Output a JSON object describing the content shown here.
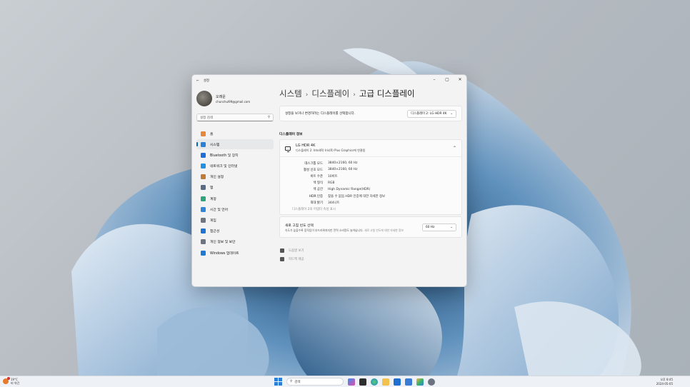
{
  "window": {
    "title": "설정",
    "controls": [
      "minimize",
      "maximize",
      "close"
    ]
  },
  "user": {
    "name": "오래운",
    "email": "chunchul99@gmail.com"
  },
  "search": {
    "placeholder": "설정 검색"
  },
  "sidebar": {
    "items": [
      {
        "label": "홈",
        "icon": "home-icon",
        "color": "#e6873a",
        "active": false
      },
      {
        "label": "시스템",
        "icon": "system-icon",
        "color": "#2b7fd6",
        "active": true
      },
      {
        "label": "Bluetooth 및 장치",
        "icon": "bluetooth-icon",
        "color": "#1e6fd8",
        "active": false
      },
      {
        "label": "네트워크 및 인터넷",
        "icon": "network-icon",
        "color": "#2491e0",
        "active": false
      },
      {
        "label": "개인 설정",
        "icon": "brush-icon",
        "color": "#c07a3a",
        "active": false
      },
      {
        "label": "앱",
        "icon": "apps-icon",
        "color": "#5a6b86",
        "active": false
      },
      {
        "label": "계정",
        "icon": "account-icon",
        "color": "#2fa37b",
        "active": false
      },
      {
        "label": "시간 및 언어",
        "icon": "globe-clock-icon",
        "color": "#2d86d6",
        "active": false
      },
      {
        "label": "게임",
        "icon": "gamepad-icon",
        "color": "#6f7680",
        "active": false
      },
      {
        "label": "접근성",
        "icon": "accessibility-icon",
        "color": "#1f74d0",
        "active": false
      },
      {
        "label": "개인 정보 및 보안",
        "icon": "shield-icon",
        "color": "#6c7580",
        "active": false
      },
      {
        "label": "Windows 업데이트",
        "icon": "update-icon",
        "color": "#1f7ad6",
        "active": false
      }
    ]
  },
  "breadcrumb": [
    "시스템",
    "디스플레이",
    "고급 디스플레이"
  ],
  "selector": {
    "prompt": "설정을 보거나 변경하려는 디스플레이를 선택합니다.",
    "value": "디스플레이 2: LG HDR 4K"
  },
  "display_info": {
    "section_title": "디스플레이 정보",
    "name": "LG HDR 4K",
    "subtitle": "디스플레이 2: Intel(R) Iris(R) Plus Graphics에 연결됨",
    "rows": [
      {
        "key": "데스크톱 모드",
        "value": "3840×2160, 60 Hz"
      },
      {
        "key": "활성 신호 모드",
        "value": "3840×2160, 60 Hz"
      },
      {
        "key": "비트 수준",
        "value": "10비트"
      },
      {
        "key": "색 형식",
        "value": "RGB"
      },
      {
        "key": "색 공간",
        "value": "High Dynamic Range(HDR)"
      },
      {
        "key": "HDR 인증",
        "value": "찾을 수 없음 HDR 인증에 대한 자세한 정보"
      },
      {
        "key": "최대 밝기",
        "value": "344니트"
      }
    ],
    "adapter_link": "디스플레이 2의 어댑터 속성 표시"
  },
  "refresh": {
    "title": "새로 고침 빈도 선택",
    "desc": "속도가 높을수록 움직임이 부드러워지지만 전력 소비량도 늘어납니다.",
    "link": "새로 고침 빈도에 대한 자세한 정보",
    "value": "60 Hz"
  },
  "help": [
    {
      "label": "도움말 보기",
      "icon": "help-icon"
    },
    {
      "label": "피드백 제공",
      "icon": "feedback-icon"
    }
  ],
  "taskbar": {
    "weather_temp": "19°C",
    "weather_desc": "비 약간",
    "search_label": "검색",
    "time": "오후 8:45",
    "date": "2024-05-05",
    "icons": [
      "copilot-icon",
      "task-view-icon",
      "edge-icon",
      "file-explorer-icon",
      "store-icon",
      "mail-icon",
      "photos-icon",
      "settings-icon"
    ]
  }
}
